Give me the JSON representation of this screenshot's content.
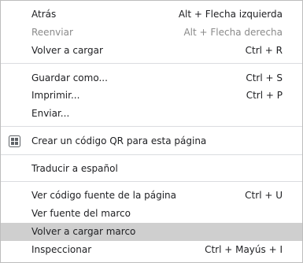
{
  "menu": {
    "items": [
      {
        "label": "Atrás",
        "shortcut": "Alt + Flecha izquierda",
        "disabled": false
      },
      {
        "label": "Reenviar",
        "shortcut": "Alt + Flecha derecha",
        "disabled": true
      },
      {
        "label": "Volver a cargar",
        "shortcut": "Ctrl + R",
        "disabled": false
      },
      {
        "label": "Guardar como...",
        "shortcut": "Ctrl + S",
        "disabled": false
      },
      {
        "label": "Imprimir...",
        "shortcut": "Ctrl + P",
        "disabled": false
      },
      {
        "label": "Enviar...",
        "shortcut": "",
        "disabled": false
      },
      {
        "label": "Crear un código QR para esta página",
        "shortcut": "",
        "icon": "qr-code-icon",
        "disabled": false
      },
      {
        "label": "Traducir a español",
        "shortcut": "",
        "disabled": false
      },
      {
        "label": "Ver código fuente de la página",
        "shortcut": "Ctrl + U",
        "disabled": false
      },
      {
        "label": "Ver fuente del marco",
        "shortcut": "",
        "disabled": false
      },
      {
        "label": "Volver a cargar marco",
        "shortcut": "",
        "highlighted": true,
        "disabled": false
      },
      {
        "label": "Inspeccionar",
        "shortcut": "Ctrl + Mayús + I",
        "disabled": false
      }
    ]
  },
  "colors": {
    "highlight": "#cfcfcf",
    "text": "#202124",
    "disabled_text": "#8a8a8a",
    "separator": "#dadce0"
  }
}
